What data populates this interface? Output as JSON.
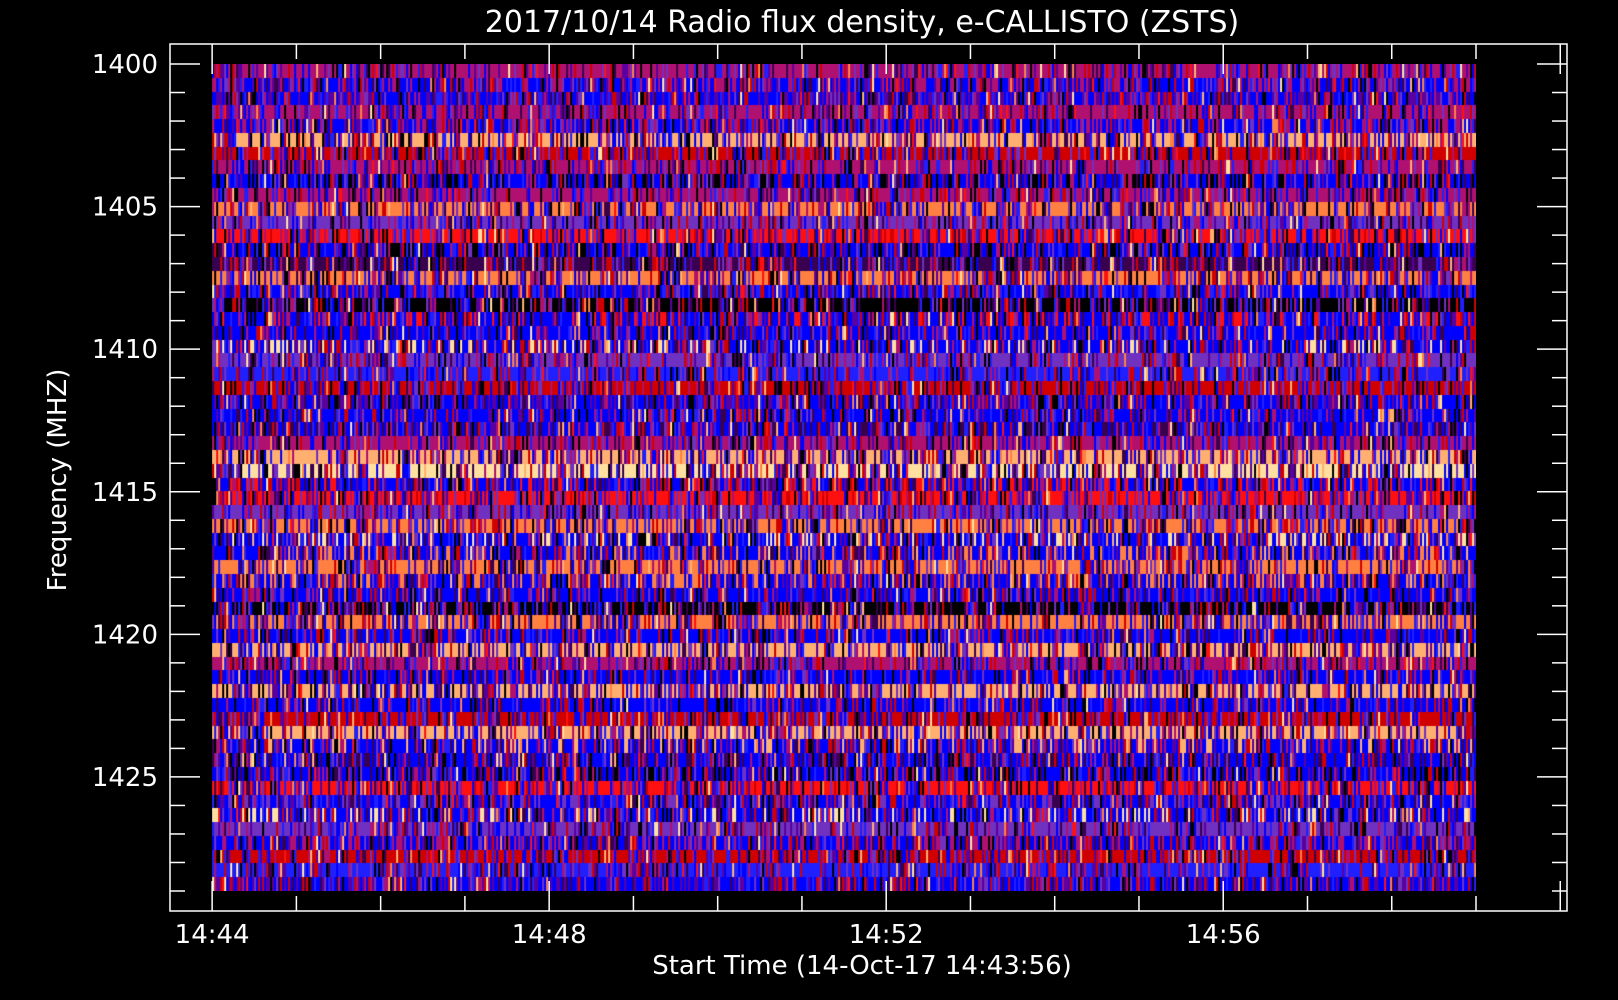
{
  "chart_data": {
    "type": "heatmap",
    "title": "2017/10/14  Radio flux density, e-CALLISTO (ZSTS)",
    "xlabel": "Start Time (14-Oct-17 14:43:56)",
    "ylabel": "Frequency (MHZ)",
    "x_tick_labels": [
      "14:44",
      "14:48",
      "14:52",
      "14:56"
    ],
    "x_tick_values_min": [
      0,
      4,
      8,
      12
    ],
    "xlim_min": [
      -0.5,
      16.08
    ],
    "data_x_range_min": [
      0,
      15
    ],
    "y_tick_labels": [
      "1400",
      "1405",
      "1410",
      "1415",
      "1420",
      "1425"
    ],
    "y_tick_values": [
      1400,
      1405,
      1410,
      1415,
      1420,
      1425
    ],
    "ylim": [
      1400,
      1429
    ],
    "y_inverted": true,
    "frequency_channels": 60,
    "colormap": [
      "#000000",
      "#3a0050",
      "#5a00a0",
      "#0000ff",
      "#2020ff",
      "#7030c0",
      "#b01070",
      "#d00000",
      "#ff1010",
      "#ff8040",
      "#ffb070",
      "#ffe0a0"
    ]
  }
}
